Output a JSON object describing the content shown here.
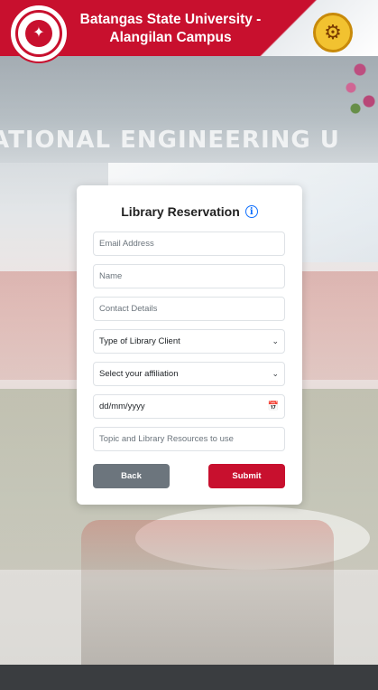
{
  "header": {
    "title_line1": "Batangas State University -",
    "title_line2": "Alangilan Campus"
  },
  "background": {
    "sign_text": "ATIONAL ENGINEERING U"
  },
  "form": {
    "title": "Library Reservation",
    "email": {
      "placeholder": "Email Address"
    },
    "name": {
      "placeholder": "Name"
    },
    "contact": {
      "placeholder": "Contact Details"
    },
    "client_type": {
      "selected": "Type of Library Client"
    },
    "affiliation": {
      "selected": "Select your affiliation"
    },
    "date": {
      "value": "dd/mm/yyyy"
    },
    "topic": {
      "placeholder": "Topic and Library Resources to use"
    },
    "back_label": "Back",
    "submit_label": "Submit"
  },
  "colors": {
    "brand_red": "#c8102e",
    "back_gray": "#6c757d",
    "info_blue": "#0d6efd"
  },
  "icons": {
    "info": "info-circle-icon",
    "chevron": "chevron-down-icon",
    "calendar": "calendar-icon"
  }
}
